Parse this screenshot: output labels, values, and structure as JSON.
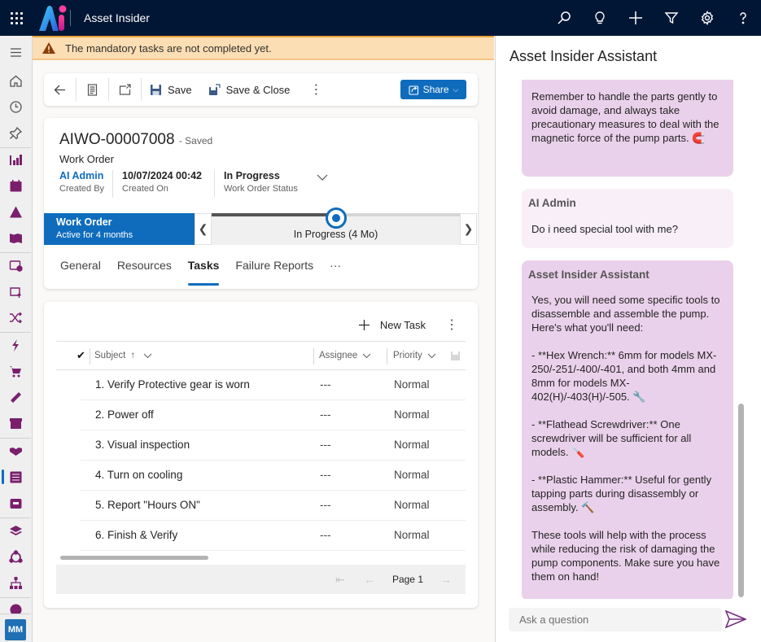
{
  "app": {
    "title": "Asset Insider",
    "topbar_icons": [
      "search-icon",
      "lightbulb-icon",
      "plus-icon",
      "filter-icon",
      "gear-icon",
      "help-icon"
    ]
  },
  "leftnav": {
    "items": [
      "menu",
      "home",
      "recent",
      "pinned",
      "dashboards",
      "calendar",
      "alerts",
      "knowledge",
      "work-order-billing",
      "asset-upload",
      "workflows",
      "power",
      "purchase",
      "tickets",
      "store",
      "agreements",
      "work-orders",
      "inventory",
      "layers",
      "collaboration",
      "hierarchy",
      "global"
    ],
    "active": "work-orders",
    "user_initials": "MM"
  },
  "notification": {
    "text": "The mandatory tasks are not completed yet."
  },
  "commandbar": {
    "save_label": "Save",
    "save_close_label": "Save & Close",
    "share_label": "Share"
  },
  "record": {
    "id": "AIWO-00007008",
    "save_state": "- Saved",
    "entity": "Work Order",
    "created_by": {
      "value": "AI Admin",
      "label": "Created By"
    },
    "created_on": {
      "value": "10/07/2024 00:42",
      "label": "Created On"
    },
    "status": {
      "value": "In Progress",
      "label": "Work Order Status"
    }
  },
  "process": {
    "stage_title": "Work Order",
    "stage_subtitle": "Active for 4 months",
    "current_stage": "In Progress  (4 Mo)",
    "progress_fraction": 0.5
  },
  "tabs": [
    {
      "label": "General"
    },
    {
      "label": "Resources"
    },
    {
      "label": "Tasks",
      "active": true
    },
    {
      "label": "Failure Reports"
    },
    {
      "label": "···"
    }
  ],
  "tasks_grid": {
    "new_task_label": "New Task",
    "columns": {
      "subject": "Subject",
      "assignee": "Assignee",
      "priority": "Priority"
    },
    "rows": [
      {
        "subject": "1. Verify Protective gear is worn",
        "assignee": "---",
        "priority": "Normal"
      },
      {
        "subject": "2. Power off",
        "assignee": "---",
        "priority": "Normal"
      },
      {
        "subject": "3. Visual inspection",
        "assignee": "---",
        "priority": "Normal"
      },
      {
        "subject": "4. Turn on cooling",
        "assignee": "---",
        "priority": "Normal"
      },
      {
        "subject": "5. Report \"Hours ON\"",
        "assignee": "---",
        "priority": "Normal"
      },
      {
        "subject": "6. Finish & Verify",
        "assignee": "---",
        "priority": "Normal"
      }
    ],
    "page_label": "Page 1"
  },
  "assistant": {
    "title": "Asset Insider Assistant",
    "messages": [
      {
        "role": "bot",
        "body": "the O-ring surface. 💧\n\nRemember to handle the parts gently to avoid damage, and always take precautionary measures to deal with the magnetic force of the pump parts. 🧲"
      },
      {
        "role": "user",
        "name": "AI Admin",
        "body": "Do i need special tool with me?"
      },
      {
        "role": "bot",
        "name": "Asset Insider Assistant",
        "body": "Yes, you will need some specific tools to disassemble and assemble the pump. Here's what you'll need:\n\n- **Hex Wrench:** 6mm for models MX-250/-251/-400/-401, and both 4mm and 8mm for models MX-402(H)/-403(H)/-505. 🔧\n\n- **Flathead Screwdriver:** One screwdriver will be sufficient for all models. 🪛\n\n- **Plastic Hammer:** Useful for gently tapping parts during disassembly or assembly. 🔨\n\nThese tools will help with the process while reducing the risk of damaging the pump components. Make sure you have them on hand!"
      }
    ],
    "input_placeholder": "Ask a question"
  },
  "colors": {
    "topbar": "#001634",
    "accent": "#0f6cbd",
    "warning_bg": "#fcdeb4",
    "bot_bubble": "#ead1eb",
    "user_bubble": "#f8eff8",
    "nav_icon": "#7a1f6e"
  }
}
